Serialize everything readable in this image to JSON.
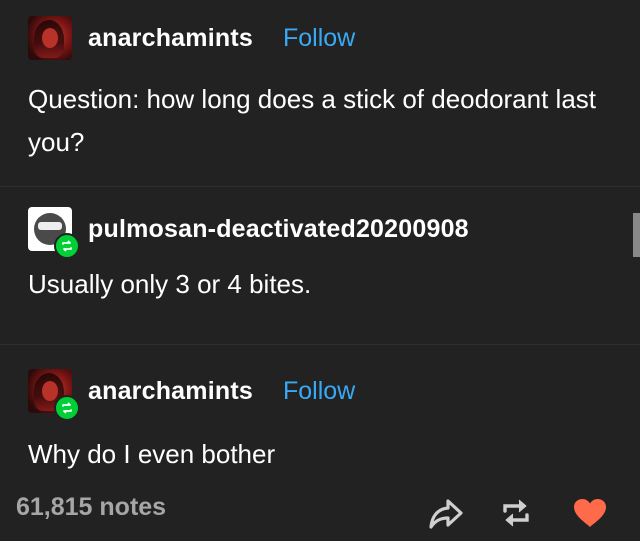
{
  "posts": [
    {
      "username": "anarchamints",
      "follow_label": "Follow",
      "text": "Question: how long does a stick of deodorant last you?"
    },
    {
      "username": "pulmosan-deactivated20200908",
      "text": "Usually only 3 or 4 bites."
    },
    {
      "username": "anarchamints",
      "follow_label": "Follow",
      "text": "Why do I even bother"
    }
  ],
  "footer": {
    "notes": "61,815 notes",
    "icons": [
      "share-icon",
      "reblog-icon",
      "like-heart-icon"
    ]
  },
  "colors": {
    "background": "#222222",
    "follow": "#39a9f5",
    "reblog_badge": "#00cf35",
    "heart": "#ff6a4a",
    "notes": "#a6a6a6"
  }
}
